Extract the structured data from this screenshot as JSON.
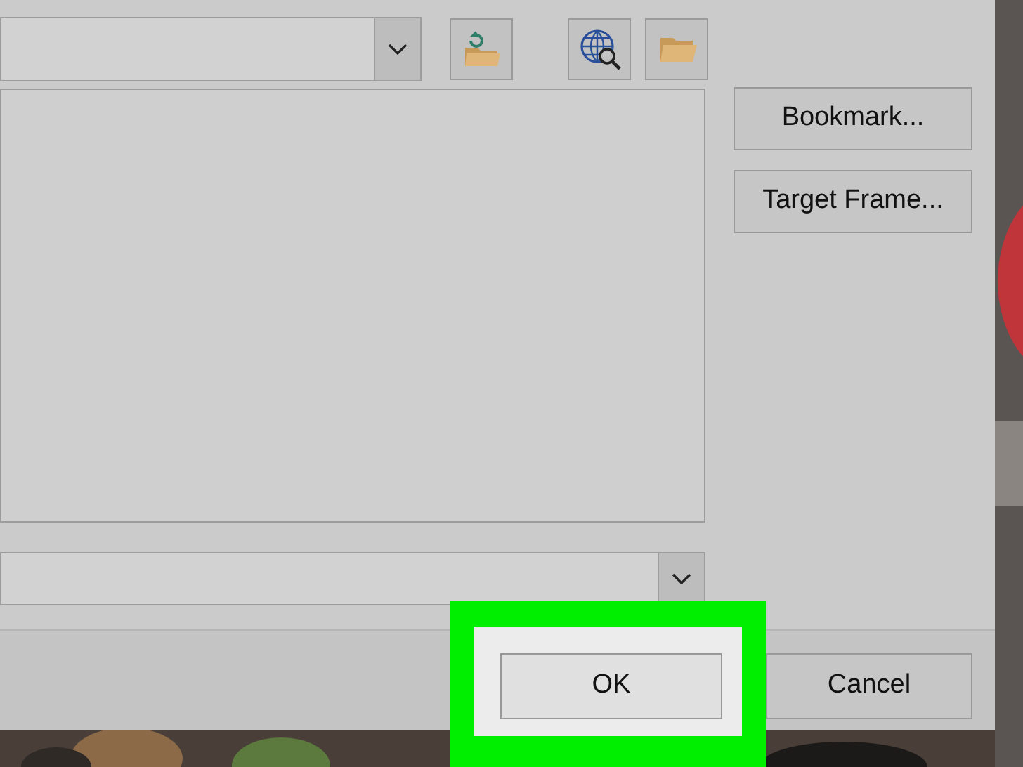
{
  "side_buttons": [
    {
      "label": "Bookmark..."
    },
    {
      "label": "Target Frame..."
    }
  ],
  "dialog_buttons": [
    {
      "label": "OK",
      "highlighted": true
    },
    {
      "label": "Cancel",
      "highlighted": false
    }
  ]
}
